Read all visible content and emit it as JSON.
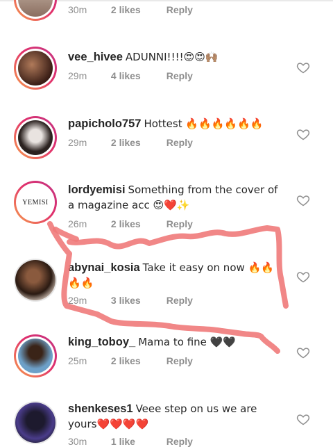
{
  "comments": [
    {
      "username": "",
      "text": "",
      "time": "30m",
      "likes": "2 likes",
      "reply": "Reply"
    },
    {
      "username": "vee_hivee",
      "text": "ADUNNI!!!!😍😍🙌🏽",
      "time": "29m",
      "likes": "4 likes",
      "reply": "Reply"
    },
    {
      "username": "papicholo757",
      "text": "Hottest 🔥🔥🔥🔥🔥🔥",
      "time": "29m",
      "likes": "2 likes",
      "reply": "Reply"
    },
    {
      "username": "lordyemisi",
      "text": "Something from the cover of a magazine acc 😍❤️✨",
      "time": "26m",
      "likes": "2 likes",
      "reply": "Reply",
      "avatar_text": "YEMISI"
    },
    {
      "username": "abynai_kosia",
      "text": "Take it easy on now 🔥🔥🔥🔥",
      "time": "29m",
      "likes": "3 likes",
      "reply": "Reply"
    },
    {
      "username": "king_toboy_",
      "text": "Mama to fine 🖤🖤",
      "time": "25m",
      "likes": "2 likes",
      "reply": "Reply"
    },
    {
      "username": "shenkeses1",
      "text": "Veee step on us we are yours❤️❤️❤️❤️",
      "time": "30m",
      "likes": "1 like",
      "reply": "Reply"
    }
  ],
  "colors": {
    "scribble": "#f07a7a",
    "meta": "#8e8e8e",
    "story_ring": "#e1306c"
  },
  "icons": {
    "like": "heart-outline-icon"
  }
}
